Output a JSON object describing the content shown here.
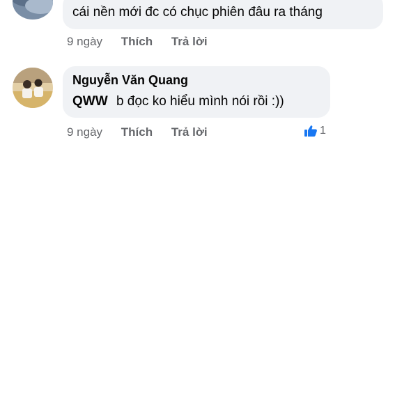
{
  "comments": [
    {
      "author": "",
      "text": "cái nền mới đc có chục phiên đâu ra tháng",
      "time": "9 ngày",
      "like_label": "Thích",
      "reply_label": "Trả lời"
    },
    {
      "author": "Nguyễn Văn Quang",
      "mention": "QWW",
      "text": "b đọc ko hiểu mình nói rồi :))",
      "time": "9 ngày",
      "like_label": "Thích",
      "reply_label": "Trả lời",
      "reaction_icon": "thumbs-up-icon",
      "reaction_count": "1"
    }
  ],
  "colors": {
    "bubble_bg": "#f0f2f5",
    "meta_text": "#65676b",
    "like_blue": "#1877f2"
  }
}
